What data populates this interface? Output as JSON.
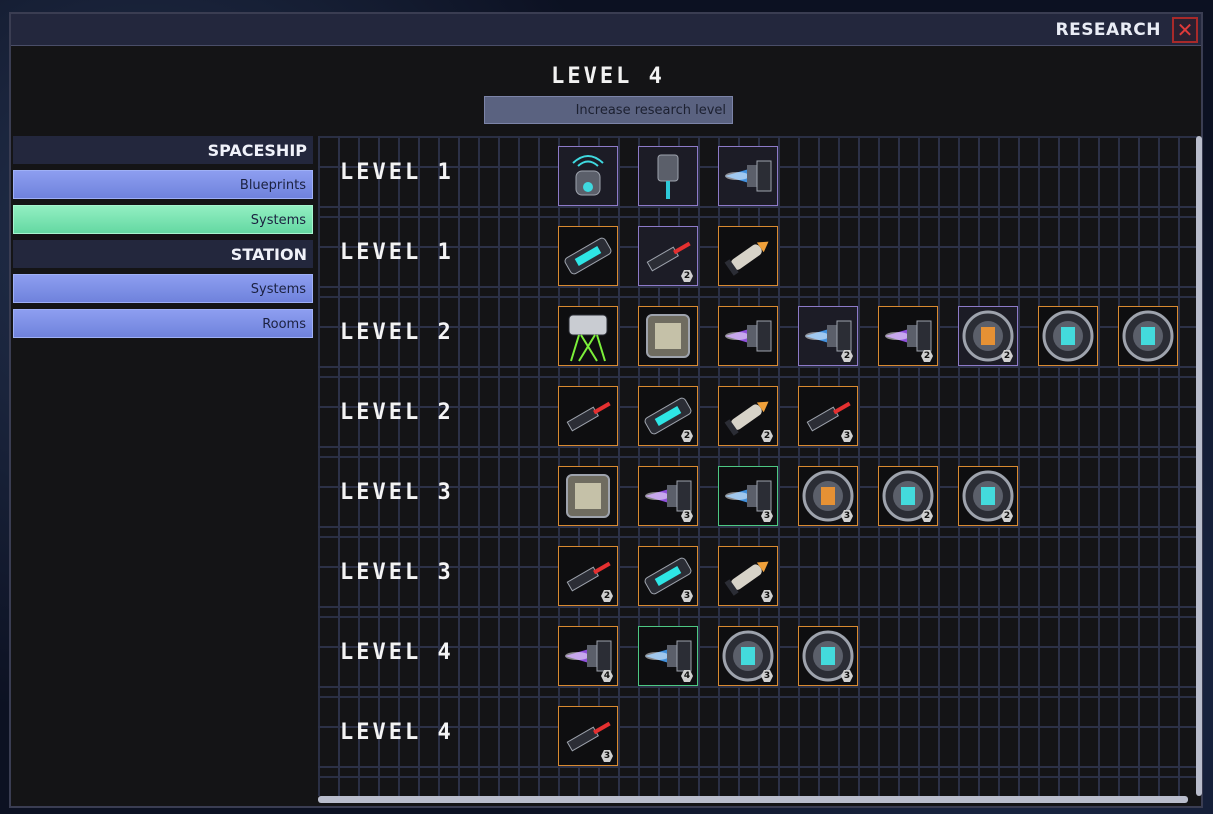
{
  "window": {
    "title": "RESEARCH",
    "close_icon": "close-icon"
  },
  "header": {
    "level": "LEVEL 4",
    "increase_button": "Increase research level"
  },
  "sidebar": {
    "sections": [
      {
        "title": "SPACESHIP",
        "items": [
          {
            "label": "Blueprints",
            "active": false
          },
          {
            "label": "Systems",
            "active": true
          }
        ]
      },
      {
        "title": "STATION",
        "items": [
          {
            "label": "Systems",
            "active": false
          },
          {
            "label": "Rooms",
            "active": false
          }
        ]
      }
    ]
  },
  "rows": [
    {
      "label": "LEVEL 1",
      "items": [
        {
          "icon": "scanner-icon",
          "style": "purple",
          "badge": ""
        },
        {
          "icon": "beam-turret-icon",
          "style": "purple",
          "badge": ""
        },
        {
          "icon": "blue-thruster-icon",
          "style": "purple",
          "badge": ""
        }
      ]
    },
    {
      "label": "LEVEL 1",
      "items": [
        {
          "icon": "plasma-cannon-icon",
          "style": "orange",
          "badge": ""
        },
        {
          "icon": "laser-gun-icon",
          "style": "purple",
          "badge": "2"
        },
        {
          "icon": "missile-launcher-icon",
          "style": "orange",
          "badge": ""
        }
      ]
    },
    {
      "label": "LEVEL 2",
      "items": [
        {
          "icon": "tractor-beam-icon",
          "style": "orange",
          "badge": ""
        },
        {
          "icon": "armor-module-icon",
          "style": "orange",
          "badge": ""
        },
        {
          "icon": "purple-thruster-icon",
          "style": "orange",
          "badge": ""
        },
        {
          "icon": "blue-thruster-icon",
          "style": "purple",
          "badge": "2"
        },
        {
          "icon": "purple-thruster-icon",
          "style": "orange",
          "badge": "2"
        },
        {
          "icon": "reactor-orange-icon",
          "style": "purple",
          "badge": "2"
        },
        {
          "icon": "reactor-cyan-icon",
          "style": "orange",
          "badge": ""
        },
        {
          "icon": "shield-generator-icon",
          "style": "orange",
          "badge": ""
        }
      ]
    },
    {
      "label": "LEVEL 2",
      "items": [
        {
          "icon": "laser-rifle-icon",
          "style": "orange",
          "badge": ""
        },
        {
          "icon": "plasma-cannon-icon",
          "style": "orange",
          "badge": "2"
        },
        {
          "icon": "missile-launcher-icon",
          "style": "orange",
          "badge": "2"
        },
        {
          "icon": "laser-gun-icon",
          "style": "orange",
          "badge": "3"
        }
      ]
    },
    {
      "label": "LEVEL 3",
      "items": [
        {
          "icon": "cargo-crate-icon",
          "style": "orange",
          "badge": ""
        },
        {
          "icon": "purple-thruster-icon",
          "style": "orange",
          "badge": "3"
        },
        {
          "icon": "blue-thruster-icon",
          "style": "green",
          "badge": "3"
        },
        {
          "icon": "reactor-orange-icon",
          "style": "orange",
          "badge": "3"
        },
        {
          "icon": "reactor-cyan-icon",
          "style": "orange",
          "badge": "2"
        },
        {
          "icon": "shield-generator-icon",
          "style": "orange",
          "badge": "2"
        }
      ]
    },
    {
      "label": "LEVEL 3",
      "items": [
        {
          "icon": "laser-rifle-icon",
          "style": "orange",
          "badge": "2"
        },
        {
          "icon": "plasma-cannon-icon",
          "style": "orange",
          "badge": "3"
        },
        {
          "icon": "missile-launcher-icon",
          "style": "orange",
          "badge": "3"
        }
      ]
    },
    {
      "label": "LEVEL 4",
      "items": [
        {
          "icon": "purple-thruster-icon",
          "style": "orange",
          "badge": "4"
        },
        {
          "icon": "blue-thruster-icon",
          "style": "green",
          "badge": "4"
        },
        {
          "icon": "reactor-cyan-icon",
          "style": "orange",
          "badge": "3"
        },
        {
          "icon": "shield-generator-icon",
          "style": "orange",
          "badge": "3"
        }
      ]
    },
    {
      "label": "LEVEL 4",
      "items": [
        {
          "icon": "laser-rifle-icon",
          "style": "orange",
          "badge": "3"
        }
      ]
    }
  ]
}
